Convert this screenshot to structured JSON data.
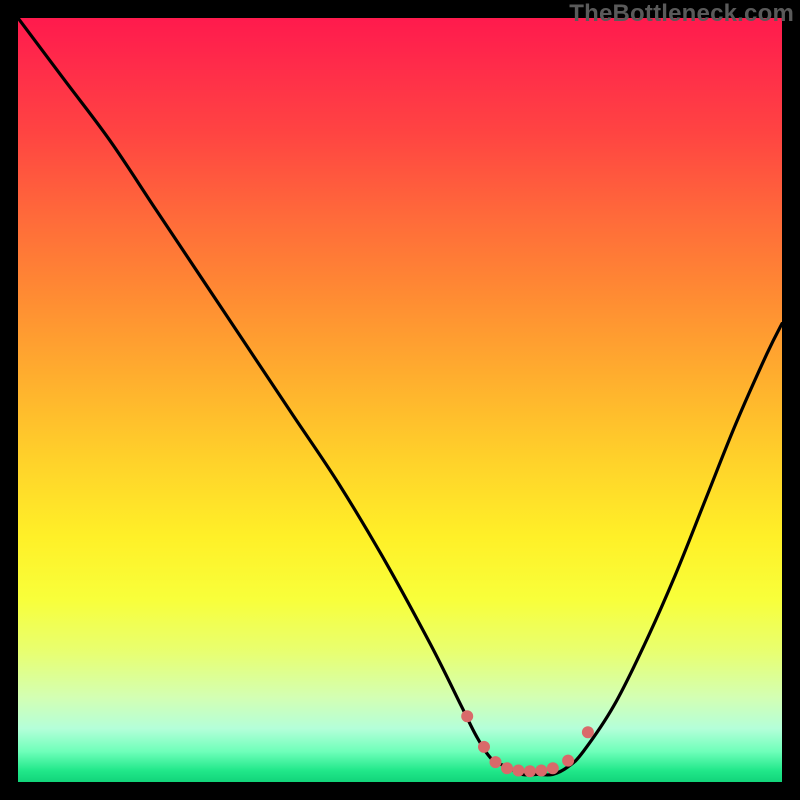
{
  "watermark": "TheBottleneck.com",
  "chart_data": {
    "type": "line",
    "title": "",
    "xlabel": "",
    "ylabel": "",
    "xlim": [
      0,
      100
    ],
    "ylim": [
      0,
      100
    ],
    "grid": false,
    "legend": false,
    "background": "bottleneck-gradient (red→yellow→green)",
    "series": [
      {
        "name": "bottleneck-curve",
        "x": [
          0,
          6,
          12,
          18,
          24,
          30,
          36,
          42,
          48,
          54,
          58,
          60,
          62,
          64,
          66,
          68,
          70,
          72,
          74,
          78,
          82,
          86,
          90,
          94,
          98,
          100
        ],
        "values": [
          100,
          92,
          84,
          75,
          66,
          57,
          48,
          39,
          29,
          18,
          10,
          6,
          3,
          2,
          1,
          1,
          1,
          2,
          4,
          10,
          18,
          27,
          37,
          47,
          56,
          60
        ]
      }
    ],
    "markers": [
      {
        "name": "curve-marker",
        "x": 58.8,
        "y": 8.6
      },
      {
        "name": "curve-marker",
        "x": 61.0,
        "y": 4.6
      },
      {
        "name": "curve-marker",
        "x": 62.5,
        "y": 2.6
      },
      {
        "name": "curve-marker",
        "x": 64.0,
        "y": 1.8
      },
      {
        "name": "curve-marker",
        "x": 65.5,
        "y": 1.5
      },
      {
        "name": "curve-marker",
        "x": 67.0,
        "y": 1.4
      },
      {
        "name": "curve-marker",
        "x": 68.5,
        "y": 1.5
      },
      {
        "name": "curve-marker",
        "x": 70.0,
        "y": 1.8
      },
      {
        "name": "curve-marker",
        "x": 72.0,
        "y": 2.8
      },
      {
        "name": "curve-marker",
        "x": 74.6,
        "y": 6.5
      }
    ],
    "marker_color": "#d96a6a",
    "marker_radius_px": 6
  }
}
